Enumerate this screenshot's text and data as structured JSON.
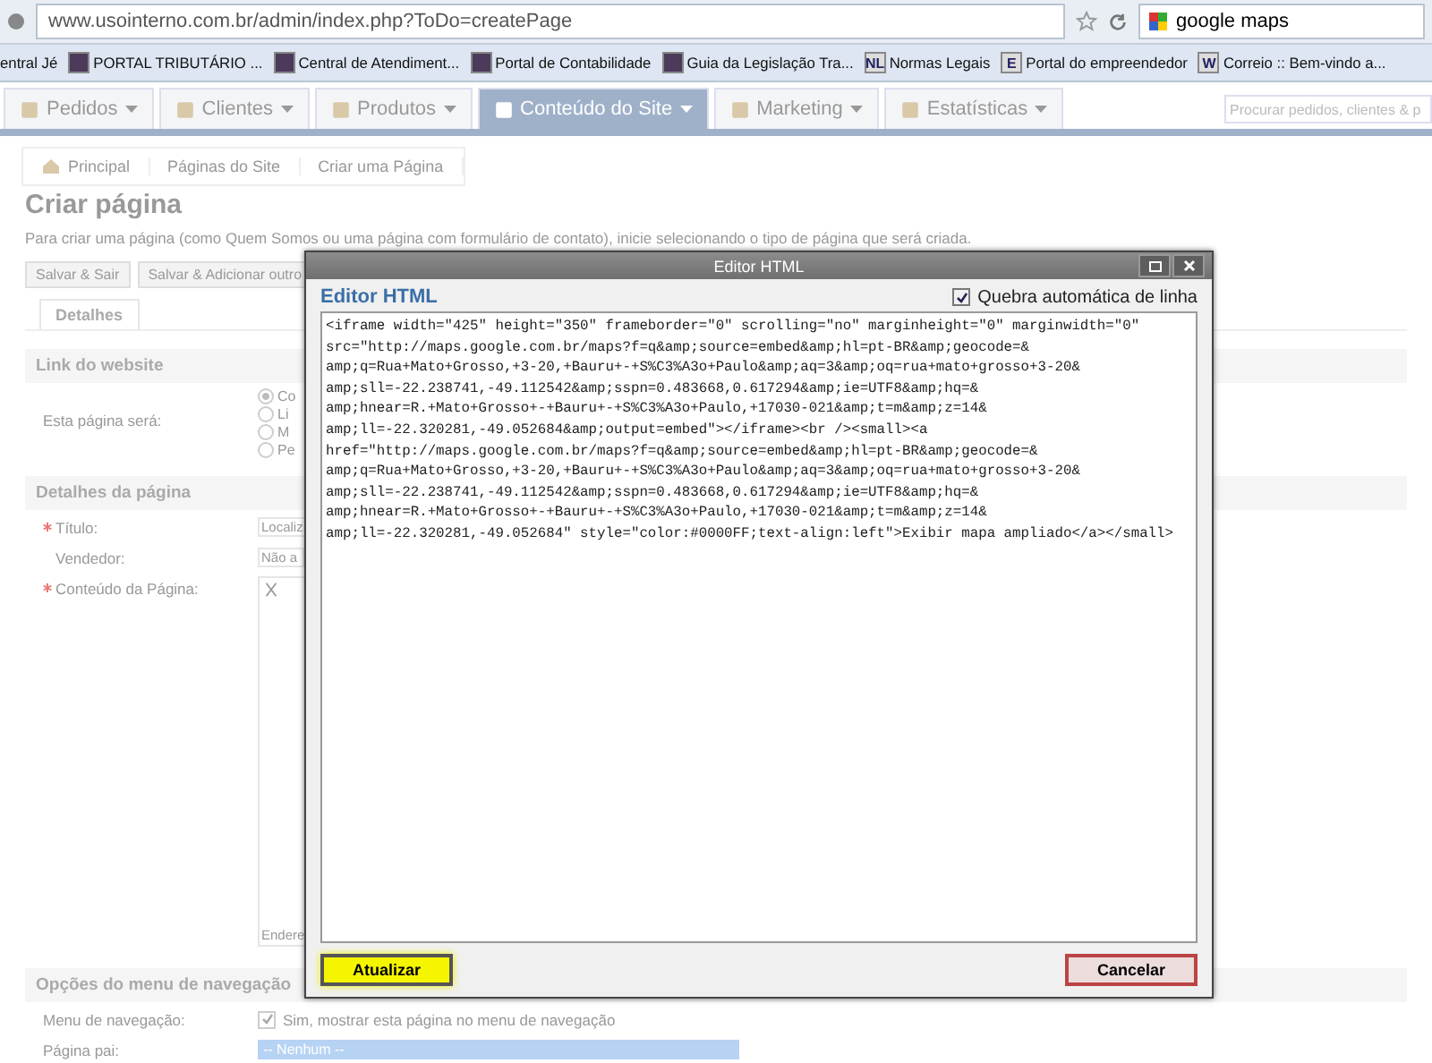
{
  "browser": {
    "url": "www.usointerno.com.br/admin/index.php?ToDo=createPage",
    "search": "google maps",
    "bookmarks": [
      {
        "label": "entral Jé"
      },
      {
        "label": "PORTAL TRIBUTÁRIO ..."
      },
      {
        "label": "Central de Atendiment..."
      },
      {
        "label": "Portal de Contabilidade"
      },
      {
        "label": "Guia da Legislação Tra..."
      },
      {
        "label": "Normas Legais",
        "badge": "NL"
      },
      {
        "label": "Portal do empreendedor",
        "badge": "E"
      },
      {
        "label": "Correio :: Bem-vindo a...",
        "badge": "W"
      }
    ]
  },
  "nav": {
    "tabs": [
      {
        "label": "Pedidos",
        "selected": false
      },
      {
        "label": "Clientes",
        "selected": false
      },
      {
        "label": "Produtos",
        "selected": false
      },
      {
        "label": "Conteúdo do Site",
        "selected": true
      },
      {
        "label": "Marketing",
        "selected": false
      },
      {
        "label": "Estatísticas",
        "selected": false
      }
    ],
    "search": {
      "placeholder": "Procurar pedidos, clientes & p"
    }
  },
  "breadcrumb": [
    "Principal",
    "Páginas do Site",
    "Criar uma Página"
  ],
  "page": {
    "title": "Criar página",
    "intro": "Para criar uma página (como Quem Somos ou uma página com formulário de contato), inicie selecionando o tipo de página que será criada.",
    "buttons": [
      "Salvar & Sair",
      "Salvar & Adicionar outro"
    ],
    "tabs": [
      {
        "label": "Detalhes",
        "selected": true
      }
    ],
    "link_section": {
      "heading": "Link do website",
      "label": "Esta página será:",
      "options": [
        {
          "label": "Co",
          "selected": true
        },
        {
          "label": "Li",
          "selected": false
        },
        {
          "label": "M",
          "selected": false
        },
        {
          "label": "Pe",
          "selected": false
        }
      ]
    },
    "details_section": {
      "heading": "Detalhes da página",
      "fields": [
        {
          "label": "Título:",
          "required": true,
          "value": "Localiz"
        },
        {
          "label": "Vendedor:",
          "required": false,
          "value": "Não a"
        }
      ],
      "content_label": "Conteúdo da Página:",
      "content_footer": "Endere"
    },
    "nav_section": {
      "heading": "Opções do menu de navegação",
      "menu_label": "Menu de navegação:",
      "menu_checkbox": {
        "label": "Sim, mostrar esta página no menu de navegação",
        "checked": true
      },
      "parent_label": "Página pai:",
      "parent_value": "-- Nenhum --"
    }
  },
  "dialog": {
    "title": "Editor HTML",
    "heading": "Editor HTML",
    "wrap": {
      "label": "Quebra automática de linha",
      "checked": true
    },
    "code": [
      "<iframe width=\"425\" height=\"350\" frameborder=\"0\" scrolling=\"no\" marginheight=\"0\" marginwidth=\"0\"",
      "src=\"http://maps.google.com.br/maps?f=q&amp;source=embed&amp;hl=pt-BR&amp;geocode=&",
      "amp;q=Rua+Mato+Grosso,+3-20,+Bauru+-+S%C3%A3o+Paulo&amp;aq=3&amp;oq=rua+mato+grosso+3-20&",
      "amp;sll=-22.238741,-49.112542&amp;sspn=0.483668,0.617294&amp;ie=UTF8&amp;hq=&",
      "amp;hnear=R.+Mato+Grosso+-+Bauru+-+S%C3%A3o+Paulo,+17030-021&amp;t=m&amp;z=14&",
      "amp;ll=-22.320281,-49.052684&amp;output=embed\"></iframe><br /><small><a",
      "href=\"http://maps.google.com.br/maps?f=q&amp;source=embed&amp;hl=pt-BR&amp;geocode=&",
      "amp;q=Rua+Mato+Grosso,+3-20,+Bauru+-+S%C3%A3o+Paulo&amp;aq=3&amp;oq=rua+mato+grosso+3-20&",
      "amp;sll=-22.238741,-49.112542&amp;sspn=0.483668,0.617294&amp;ie=UTF8&amp;hq=&",
      "amp;hnear=R.+Mato+Grosso+-+Bauru+-+S%C3%A3o+Paulo,+17030-021&amp;t=m&amp;z=14&",
      "amp;ll=-22.320281,-49.052684\" style=\"color:#0000FF;text-align:left\">Exibir mapa ampliado</a></small>"
    ],
    "buttons": [
      {
        "label": "Atualizar",
        "kind": "primary"
      },
      {
        "label": "Cancelar",
        "kind": "cancel"
      }
    ]
  }
}
